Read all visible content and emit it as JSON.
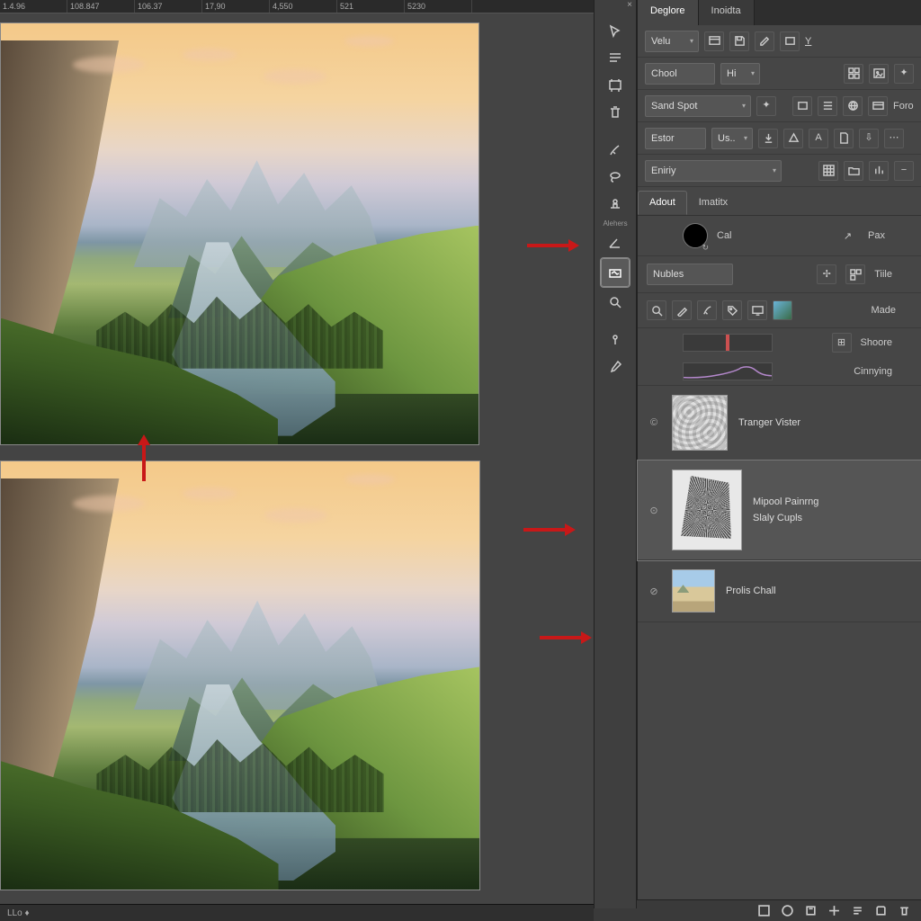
{
  "ruler": [
    "1.4.96",
    "108.847",
    "106.37",
    "17,90",
    "4,550",
    "521",
    "5230"
  ],
  "status_text": "LLo ♦",
  "tools": [
    {
      "name": "close-icon",
      "glyph": "×"
    },
    {
      "name": "selection-tool",
      "glyph": "sel"
    },
    {
      "name": "text-list-tool",
      "glyph": "lines"
    },
    {
      "name": "artboard-tool",
      "glyph": "artb"
    },
    {
      "name": "trash-tool",
      "glyph": "trash"
    },
    {
      "name": "brush-tool",
      "glyph": "brush"
    },
    {
      "name": "lasso-tool",
      "glyph": "lasso"
    },
    {
      "name": "stamp-tool",
      "glyph": "stamp"
    },
    {
      "name": "label",
      "glyph": "",
      "lbl": "Alehers"
    },
    {
      "name": "angle-tool",
      "glyph": "angle"
    },
    {
      "name": "color-thumb",
      "glyph": "thumb"
    },
    {
      "name": "zoom-tool",
      "glyph": "zoom"
    },
    {
      "name": "pin-tool",
      "glyph": "pin"
    },
    {
      "name": "eyedropper-tool",
      "glyph": "eye"
    }
  ],
  "panel_tabs": [
    "Deglore",
    "Inoidta"
  ],
  "row1": {
    "dd": "Velu",
    "icons": [
      "panel",
      "save",
      "edit",
      "rect",
      "Y"
    ]
  },
  "row2": {
    "dd": "Chool",
    "dd2": "Hi",
    "icons": [
      "grid",
      "img",
      "fx"
    ]
  },
  "row3": {
    "dd": "Sand Spot",
    "wand": "✦",
    "icons": [
      "rect2",
      "stack",
      "globe",
      "card"
    ],
    "end": "Foro"
  },
  "row4": {
    "dd": "Estor",
    "dd2": "Us..",
    "icons": [
      "dl",
      "tri",
      "aa",
      "doc",
      "down",
      "more"
    ]
  },
  "row5": {
    "dd": "Eniriy",
    "icons": [
      "grid2",
      "folders",
      "bars",
      "minus"
    ]
  },
  "subtabs": [
    "Adout",
    "Imatitx"
  ],
  "swatch": {
    "lbl1": "Cal",
    "lbl2": "Pax",
    "icon": "↗"
  },
  "nubrow": {
    "lbl": "Nubles",
    "icons": [
      "plus",
      "grid3"
    ],
    "end": "Tiile"
  },
  "toolrow": {
    "icons": [
      "search",
      "pen",
      "brush2",
      "tag",
      "screen",
      "colimg"
    ],
    "end": "Made"
  },
  "curves": {
    "r1": "Shoore",
    "r2": "Cinnying",
    "ricon": "⊞"
  },
  "layers": [
    {
      "vis": "©",
      "thumb": "swirl",
      "t1": "Tranger Vister"
    },
    {
      "vis": "⊙",
      "thumb": "noise",
      "t1": "Mipool Painrng",
      "t2": "Slaly Cupls",
      "sel": true
    },
    {
      "vis": "⊘",
      "thumb": "img",
      "t1": "Prolis Chall"
    }
  ],
  "footer_icons": [
    "a",
    "b",
    "c",
    "d",
    "e",
    "f",
    "g"
  ]
}
